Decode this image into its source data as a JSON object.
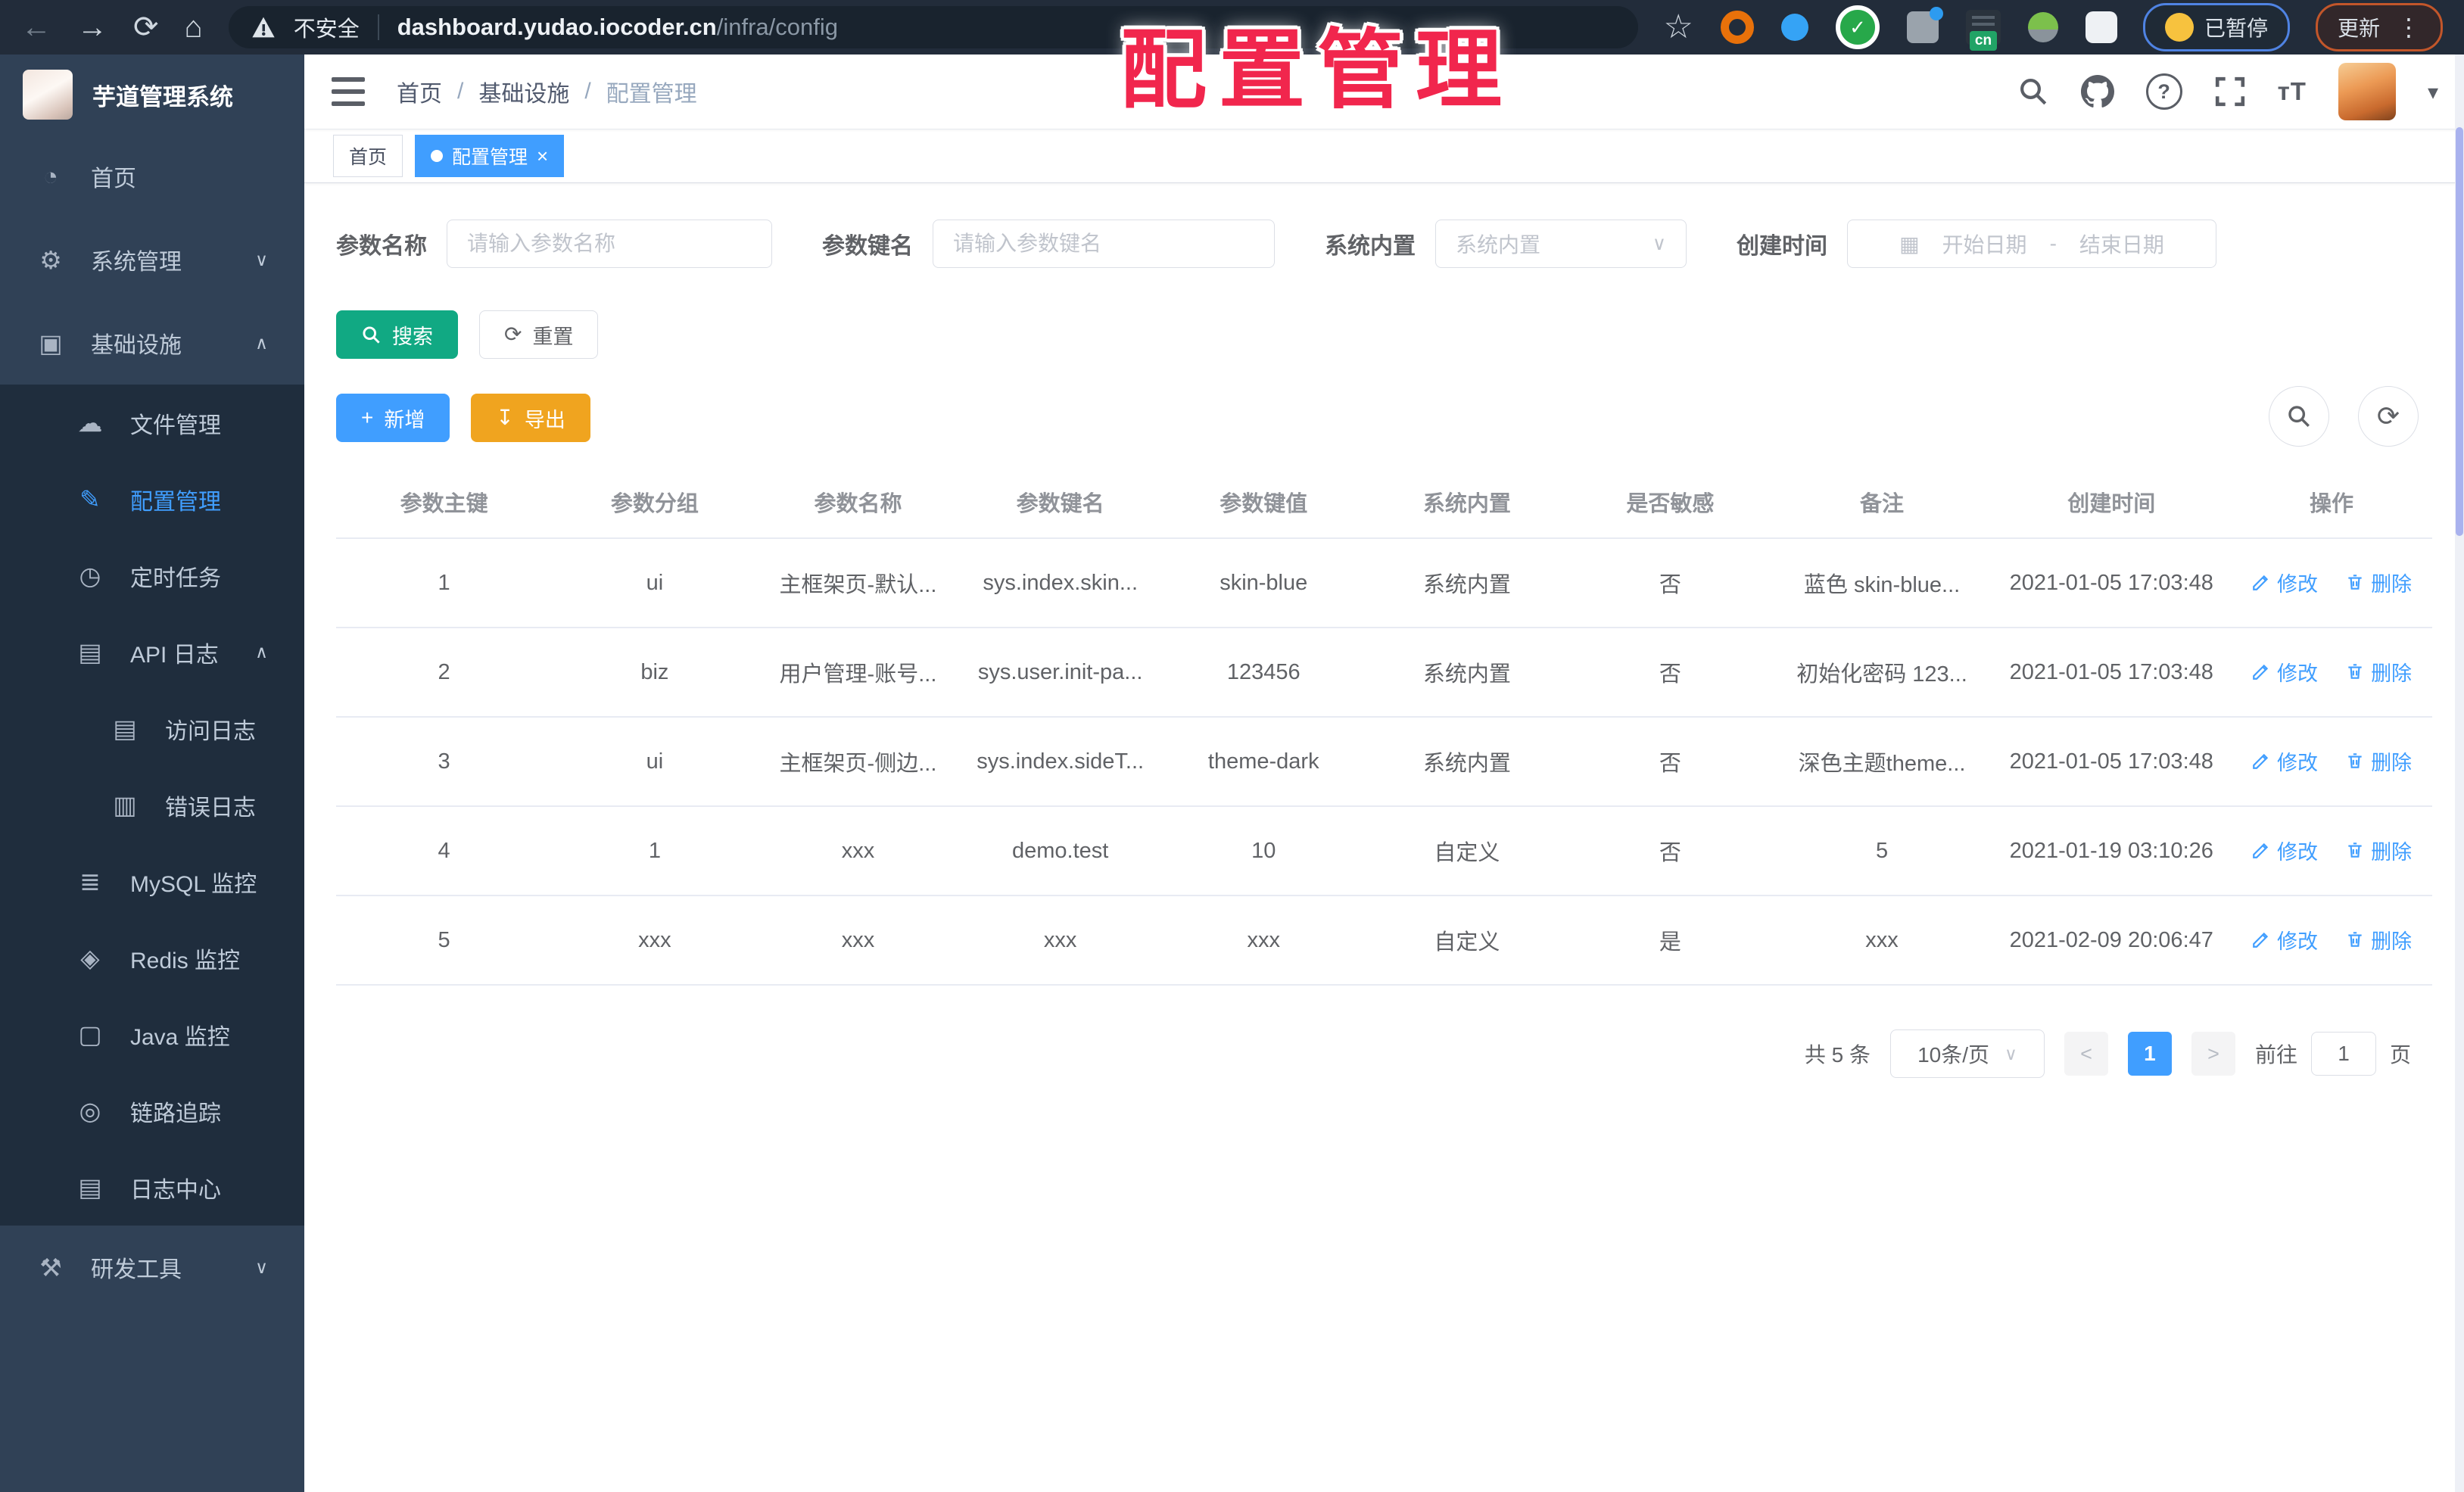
{
  "colors": {
    "accent": "#409eff",
    "success": "#11a983",
    "warning": "#f0a41f",
    "danger": "#f1264d",
    "sidebar_bg": "#304156",
    "submenu_bg": "#1f2d3d"
  },
  "overlay_title": "配置管理",
  "browser": {
    "security_label": "不安全",
    "url_host": "dashboard.yudao.iocoder.cn",
    "url_path": "/infra/config",
    "paused_label": "已暂停",
    "update_label": "更新",
    "menu_dots": "⋮",
    "extensions": [
      {
        "name": "bookmark-star-icon",
        "cls": "ext-star",
        "glyph": "☆"
      },
      {
        "name": "extension-orange-ring-icon",
        "cls": "ext-ring",
        "glyph": ""
      },
      {
        "name": "extension-pin-icon",
        "cls": "ext-pin",
        "glyph": ""
      },
      {
        "name": "extension-green-check-icon",
        "cls": "ext-check",
        "glyph": "✓"
      },
      {
        "name": "extension-grid-icon",
        "cls": "ext-grid",
        "glyph": ""
      },
      {
        "name": "extension-cn-badge-icon",
        "cls": "ext-cn",
        "glyph": "cn"
      },
      {
        "name": "extension-sprout-icon",
        "cls": "ext-sprout",
        "glyph": ""
      },
      {
        "name": "extensions-puzzle-icon",
        "cls": "ext-puzzle",
        "glyph": ""
      }
    ]
  },
  "sidebar": {
    "logo_title": "芋道管理系统",
    "items": [
      {
        "name": "sidebar-item-home",
        "label": "首页",
        "icon": "◔",
        "cls": "top",
        "chevron": ""
      },
      {
        "name": "sidebar-item-system",
        "label": "系统管理",
        "icon": "⚙",
        "cls": "top",
        "chevron": "∨"
      },
      {
        "name": "sidebar-item-infra",
        "label": "基础设施",
        "icon": "▣",
        "cls": "top",
        "chevron": "∧"
      },
      {
        "name": "sidebar-item-file",
        "label": "文件管理",
        "icon": "☁",
        "cls": "sub",
        "chevron": ""
      },
      {
        "name": "sidebar-item-config",
        "label": "配置管理",
        "icon": "✎",
        "cls": "sub active",
        "chevron": ""
      },
      {
        "name": "sidebar-item-job",
        "label": "定时任务",
        "icon": "◷",
        "cls": "sub",
        "chevron": ""
      },
      {
        "name": "sidebar-item-api-log",
        "label": "API 日志",
        "icon": "▤",
        "cls": "sub",
        "chevron": "∧"
      },
      {
        "name": "sidebar-item-access-log",
        "label": "访问日志",
        "icon": "▤",
        "cls": "sub2",
        "chevron": ""
      },
      {
        "name": "sidebar-item-error-log",
        "label": "错误日志",
        "icon": "▥",
        "cls": "sub2",
        "chevron": ""
      },
      {
        "name": "sidebar-item-mysql",
        "label": "MySQL 监控",
        "icon": "≣",
        "cls": "sub",
        "chevron": ""
      },
      {
        "name": "sidebar-item-redis",
        "label": "Redis 监控",
        "icon": "◈",
        "cls": "sub",
        "chevron": ""
      },
      {
        "name": "sidebar-item-java",
        "label": "Java 监控",
        "icon": "▢",
        "cls": "sub",
        "chevron": ""
      },
      {
        "name": "sidebar-item-tracing",
        "label": "链路追踪",
        "icon": "◎",
        "cls": "sub",
        "chevron": ""
      },
      {
        "name": "sidebar-item-log-center",
        "label": "日志中心",
        "icon": "▤",
        "cls": "sub",
        "chevron": ""
      },
      {
        "name": "sidebar-item-dev-tools",
        "label": "研发工具",
        "icon": "⚒",
        "cls": "top",
        "chevron": "∨"
      }
    ]
  },
  "header": {
    "breadcrumb": [
      "首页",
      "基础设施",
      "配置管理"
    ],
    "breadcrumb_sep": "/"
  },
  "tags": [
    {
      "name": "tab-home",
      "label": "首页",
      "cls": "",
      "close": ""
    },
    {
      "name": "tab-config",
      "label": "配置管理",
      "cls": "active",
      "close": "×"
    }
  ],
  "filters": {
    "name_label": "参数名称",
    "name_placeholder": "请输入参数名称",
    "key_label": "参数键名",
    "key_placeholder": "请输入参数键名",
    "type_label": "系统内置",
    "type_placeholder": "系统内置",
    "select_chevron": "∨",
    "date_label": "创建时间",
    "date_icon": "▦",
    "date_start": "开始日期",
    "date_sep": "-",
    "date_end": "结束日期",
    "search_label": "搜索",
    "reset_label": "重置",
    "reset_icon": "⟳"
  },
  "toolbar": {
    "add_label": "新增",
    "add_icon": "+",
    "export_label": "导出",
    "export_icon": "↧",
    "refresh_icon": "⟳"
  },
  "table": {
    "headers": [
      "参数主键",
      "参数分组",
      "参数名称",
      "参数键名",
      "参数键值",
      "系统内置",
      "是否敏感",
      "备注",
      "创建时间",
      "操作"
    ],
    "rows": [
      {
        "id": "1",
        "group": "ui",
        "name": "主框架页-默认...",
        "key": "sys.index.skin...",
        "value": "skin-blue",
        "type": "系统内置",
        "sensitive": "否",
        "remark": "蓝色 skin-blue...",
        "created": "2021-01-05 17:03:48"
      },
      {
        "id": "2",
        "group": "biz",
        "name": "用户管理-账号...",
        "key": "sys.user.init-pa...",
        "value": "123456",
        "type": "系统内置",
        "sensitive": "否",
        "remark": "初始化密码 123...",
        "created": "2021-01-05 17:03:48"
      },
      {
        "id": "3",
        "group": "ui",
        "name": "主框架页-侧边...",
        "key": "sys.index.sideT...",
        "value": "theme-dark",
        "type": "系统内置",
        "sensitive": "否",
        "remark": "深色主题theme...",
        "created": "2021-01-05 17:03:48"
      },
      {
        "id": "4",
        "group": "1",
        "name": "xxx",
        "key": "demo.test",
        "value": "10",
        "type": "自定义",
        "sensitive": "否",
        "remark": "5",
        "created": "2021-01-19 03:10:26"
      },
      {
        "id": "5",
        "group": "xxx",
        "name": "xxx",
        "key": "xxx",
        "value": "xxx",
        "type": "自定义",
        "sensitive": "是",
        "remark": "xxx",
        "created": "2021-02-09 20:06:47"
      }
    ],
    "actions": {
      "edit": "修改",
      "delete": "删除"
    }
  },
  "pagination": {
    "total": "共 5 条",
    "page_size": "10条/页",
    "chevron": "∨",
    "prev": "<",
    "page": "1",
    "next": ">",
    "goto_label": "前往",
    "goto_value": "1",
    "goto_suffix": "页"
  }
}
